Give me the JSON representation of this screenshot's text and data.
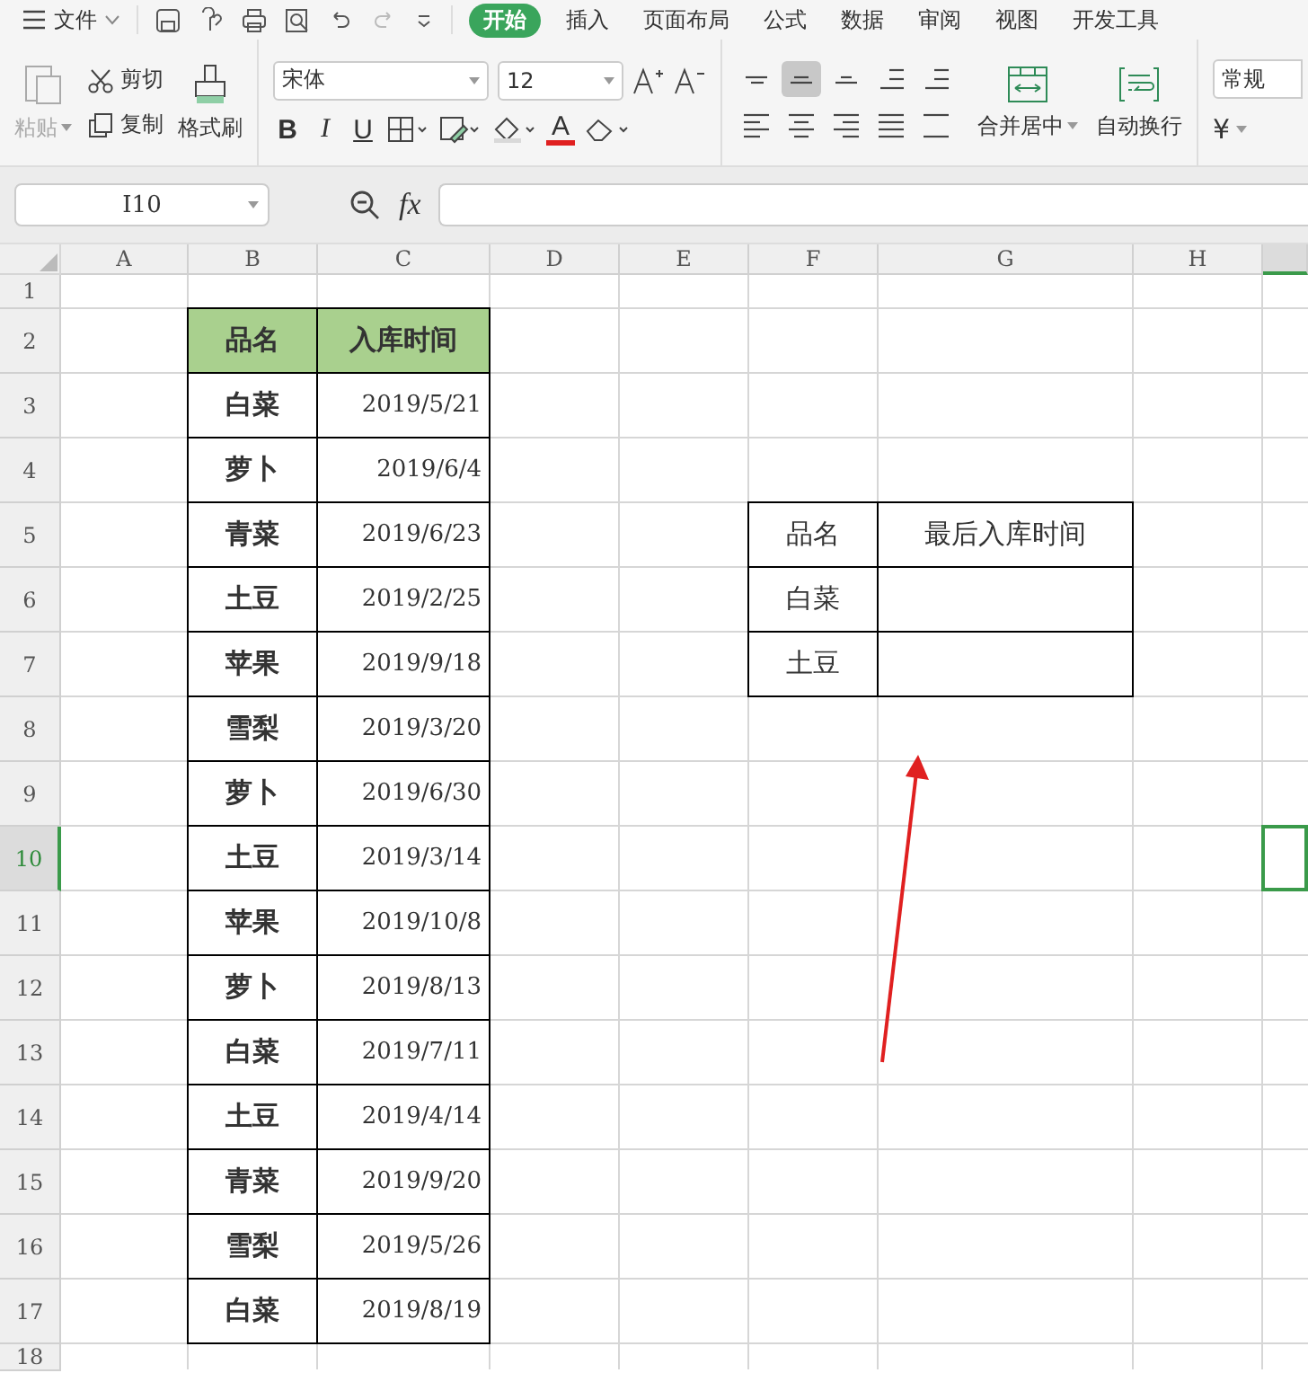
{
  "menu": {
    "file": "文件",
    "tabs": [
      {
        "label": "开始",
        "selected": true
      },
      {
        "label": "插入",
        "selected": false
      },
      {
        "label": "页面布局",
        "selected": false
      },
      {
        "label": "公式",
        "selected": false
      },
      {
        "label": "数据",
        "selected": false
      },
      {
        "label": "审阅",
        "selected": false
      },
      {
        "label": "视图",
        "selected": false
      },
      {
        "label": "开发工具",
        "selected": false
      }
    ]
  },
  "toolbar": {
    "paste": {
      "label": "粘贴",
      "disabled": true
    },
    "cut": "剪切",
    "copy": "复制",
    "format_painter": "格式刷",
    "font": "宋体",
    "font_size": "12",
    "bold": "B",
    "italic": "I",
    "underline": "U",
    "font_color": "A",
    "merge": "合并居中",
    "wrap": "自动换行",
    "number_format": "常规",
    "currency": "¥",
    "align_buttons": [
      {
        "kind": "top",
        "selected": false
      },
      {
        "kind": "middle",
        "selected": true
      },
      {
        "kind": "bottom",
        "selected": false
      },
      {
        "kind": "outdent",
        "selected": false
      },
      {
        "kind": "indent",
        "selected": false
      },
      {
        "kind": "left",
        "selected": false
      },
      {
        "kind": "center",
        "selected": false
      },
      {
        "kind": "right",
        "selected": false
      },
      {
        "kind": "justify",
        "selected": false
      },
      {
        "kind": "distribute",
        "selected": false
      }
    ]
  },
  "formula_bar": {
    "name_box": "I10",
    "fx": "fx"
  },
  "columns": [
    {
      "label": "A",
      "selected": false
    },
    {
      "label": "B",
      "selected": false
    },
    {
      "label": "C",
      "selected": false
    },
    {
      "label": "D",
      "selected": false
    },
    {
      "label": "E",
      "selected": false
    },
    {
      "label": "F",
      "selected": false
    },
    {
      "label": "G",
      "selected": false
    },
    {
      "label": "H",
      "selected": false
    },
    {
      "selected": true
    }
  ],
  "rows": [
    {
      "label": "1",
      "selected": false
    },
    {
      "label": "2",
      "selected": false
    },
    {
      "label": "3",
      "selected": false
    },
    {
      "label": "4",
      "selected": false
    },
    {
      "label": "5",
      "selected": false
    },
    {
      "label": "6",
      "selected": false
    },
    {
      "label": "7",
      "selected": false
    },
    {
      "label": "8",
      "selected": false
    },
    {
      "label": "9",
      "selected": false
    },
    {
      "label": "10",
      "selected": true
    },
    {
      "label": "11",
      "selected": false
    },
    {
      "label": "12",
      "selected": false
    },
    {
      "label": "13",
      "selected": false
    },
    {
      "label": "14",
      "selected": false
    },
    {
      "label": "15",
      "selected": false
    },
    {
      "label": "16",
      "selected": false
    },
    {
      "label": "17",
      "selected": false
    },
    {
      "label": "18",
      "selected": false
    }
  ],
  "table_1": {
    "columns": [
      "品名",
      "入库时间"
    ],
    "rows": [
      [
        "白菜",
        "2019/5/21"
      ],
      [
        "萝卜",
        "2019/6/4"
      ],
      [
        "青菜",
        "2019/6/23"
      ],
      [
        "土豆",
        "2019/2/25"
      ],
      [
        "苹果",
        "2019/9/18"
      ],
      [
        "雪梨",
        "2019/3/20"
      ],
      [
        "萝卜",
        "2019/6/30"
      ],
      [
        "土豆",
        "2019/3/14"
      ],
      [
        "苹果",
        "2019/10/8"
      ],
      [
        "萝卜",
        "2019/8/13"
      ],
      [
        "白菜",
        "2019/7/11"
      ],
      [
        "土豆",
        "2019/4/14"
      ],
      [
        "青菜",
        "2019/9/20"
      ],
      [
        "雪梨",
        "2019/5/26"
      ],
      [
        "白菜",
        "2019/8/19"
      ]
    ]
  },
  "table_2": {
    "columns": [
      "品名",
      "最后入库时间"
    ],
    "rows": [
      [
        "白菜"
      ],
      [
        "土豆"
      ]
    ]
  }
}
